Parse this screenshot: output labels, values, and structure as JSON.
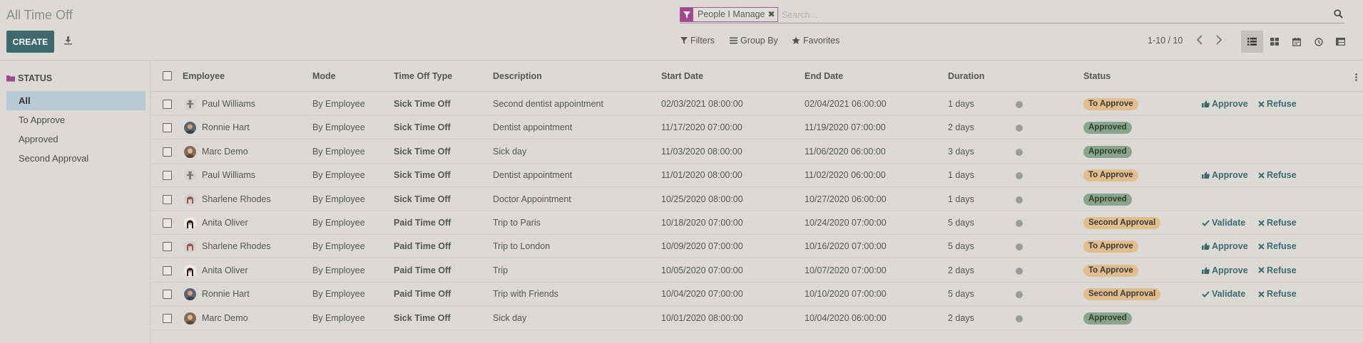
{
  "page": {
    "title": "All Time Off"
  },
  "toolbar": {
    "create_label": "CREATE"
  },
  "search": {
    "facet_label": "People I Manage",
    "placeholder": "Search..."
  },
  "filters": {
    "filters_label": "Filters",
    "group_by_label": "Group By",
    "favorites_label": "Favorites"
  },
  "pager": {
    "text": "1-10 / 10"
  },
  "sidebar": {
    "heading": "STATUS",
    "items": [
      {
        "label": "All",
        "active": true
      },
      {
        "label": "To Approve",
        "active": false
      },
      {
        "label": "Approved",
        "active": false
      },
      {
        "label": "Second Approval",
        "active": false
      }
    ]
  },
  "table": {
    "headers": {
      "employee": "Employee",
      "mode": "Mode",
      "type": "Time Off Type",
      "description": "Description",
      "start": "Start Date",
      "end": "End Date",
      "duration": "Duration",
      "status": "Status"
    },
    "rows": [
      {
        "employee": "Paul Williams",
        "mode": "By Employee",
        "type": "Sick Time Off",
        "description": "Second dentist appointment",
        "start": "02/03/2021 08:00:00",
        "end": "02/04/2021 06:00:00",
        "duration": "1 days",
        "status": "To Approve",
        "status_kind": "warn",
        "action1": "Approve",
        "action2": "Refuse",
        "avatar": "paul"
      },
      {
        "employee": "Ronnie Hart",
        "mode": "By Employee",
        "type": "Sick Time Off",
        "description": "Dentist appointment",
        "start": "11/17/2020 07:00:00",
        "end": "11/19/2020 07:00:00",
        "duration": "2 days",
        "status": "Approved",
        "status_kind": "ok",
        "action1": "",
        "action2": "",
        "avatar": "ronnie"
      },
      {
        "employee": "Marc Demo",
        "mode": "By Employee",
        "type": "Sick Time Off",
        "description": "Sick day",
        "start": "11/03/2020 08:00:00",
        "end": "11/06/2020 06:00:00",
        "duration": "3 days",
        "status": "Approved",
        "status_kind": "ok",
        "action1": "",
        "action2": "",
        "avatar": "marc"
      },
      {
        "employee": "Paul Williams",
        "mode": "By Employee",
        "type": "Sick Time Off",
        "description": "Dentist appointment",
        "start": "11/01/2020 08:00:00",
        "end": "11/02/2020 06:00:00",
        "duration": "1 days",
        "status": "To Approve",
        "status_kind": "warn",
        "action1": "Approve",
        "action2": "Refuse",
        "avatar": "paul"
      },
      {
        "employee": "Sharlene Rhodes",
        "mode": "By Employee",
        "type": "Sick Time Off",
        "description": "Doctor Appointment",
        "start": "10/25/2020 08:00:00",
        "end": "10/27/2020 06:00:00",
        "duration": "1 days",
        "status": "Approved",
        "status_kind": "ok",
        "action1": "",
        "action2": "",
        "avatar": "sharlene"
      },
      {
        "employee": "Anita Oliver",
        "mode": "By Employee",
        "type": "Paid Time Off",
        "description": "Trip to Paris",
        "start": "10/18/2020 07:00:00",
        "end": "10/24/2020 07:00:00",
        "duration": "5 days",
        "status": "Second Approval",
        "status_kind": "warn",
        "action1": "Validate",
        "action2": "Refuse",
        "avatar": "anita"
      },
      {
        "employee": "Sharlene Rhodes",
        "mode": "By Employee",
        "type": "Paid Time Off",
        "description": "Trip to London",
        "start": "10/09/2020 07:00:00",
        "end": "10/16/2020 07:00:00",
        "duration": "5 days",
        "status": "To Approve",
        "status_kind": "warn",
        "action1": "Approve",
        "action2": "Refuse",
        "avatar": "sharlene"
      },
      {
        "employee": "Anita Oliver",
        "mode": "By Employee",
        "type": "Paid Time Off",
        "description": "Trip",
        "start": "10/05/2020 07:00:00",
        "end": "10/07/2020 07:00:00",
        "duration": "2 days",
        "status": "To Approve",
        "status_kind": "warn",
        "action1": "Approve",
        "action2": "Refuse",
        "avatar": "anita"
      },
      {
        "employee": "Ronnie Hart",
        "mode": "By Employee",
        "type": "Paid Time Off",
        "description": "Trip with Friends",
        "start": "10/04/2020 07:00:00",
        "end": "10/10/2020 07:00:00",
        "duration": "5 days",
        "status": "Second Approval",
        "status_kind": "warn",
        "action1": "Validate",
        "action2": "Refuse",
        "avatar": "ronnie"
      },
      {
        "employee": "Marc Demo",
        "mode": "By Employee",
        "type": "Sick Time Off",
        "description": "Sick day",
        "start": "10/01/2020 08:00:00",
        "end": "10/04/2020 06:00:00",
        "duration": "2 days",
        "status": "Approved",
        "status_kind": "ok",
        "action1": "",
        "action2": "",
        "avatar": "marc"
      }
    ]
  },
  "colors": {
    "accent": "#3e6a6d",
    "filter_facet": "#a3478f",
    "warn_badge": "#e3bd8c",
    "ok_badge": "#8aa58a"
  }
}
